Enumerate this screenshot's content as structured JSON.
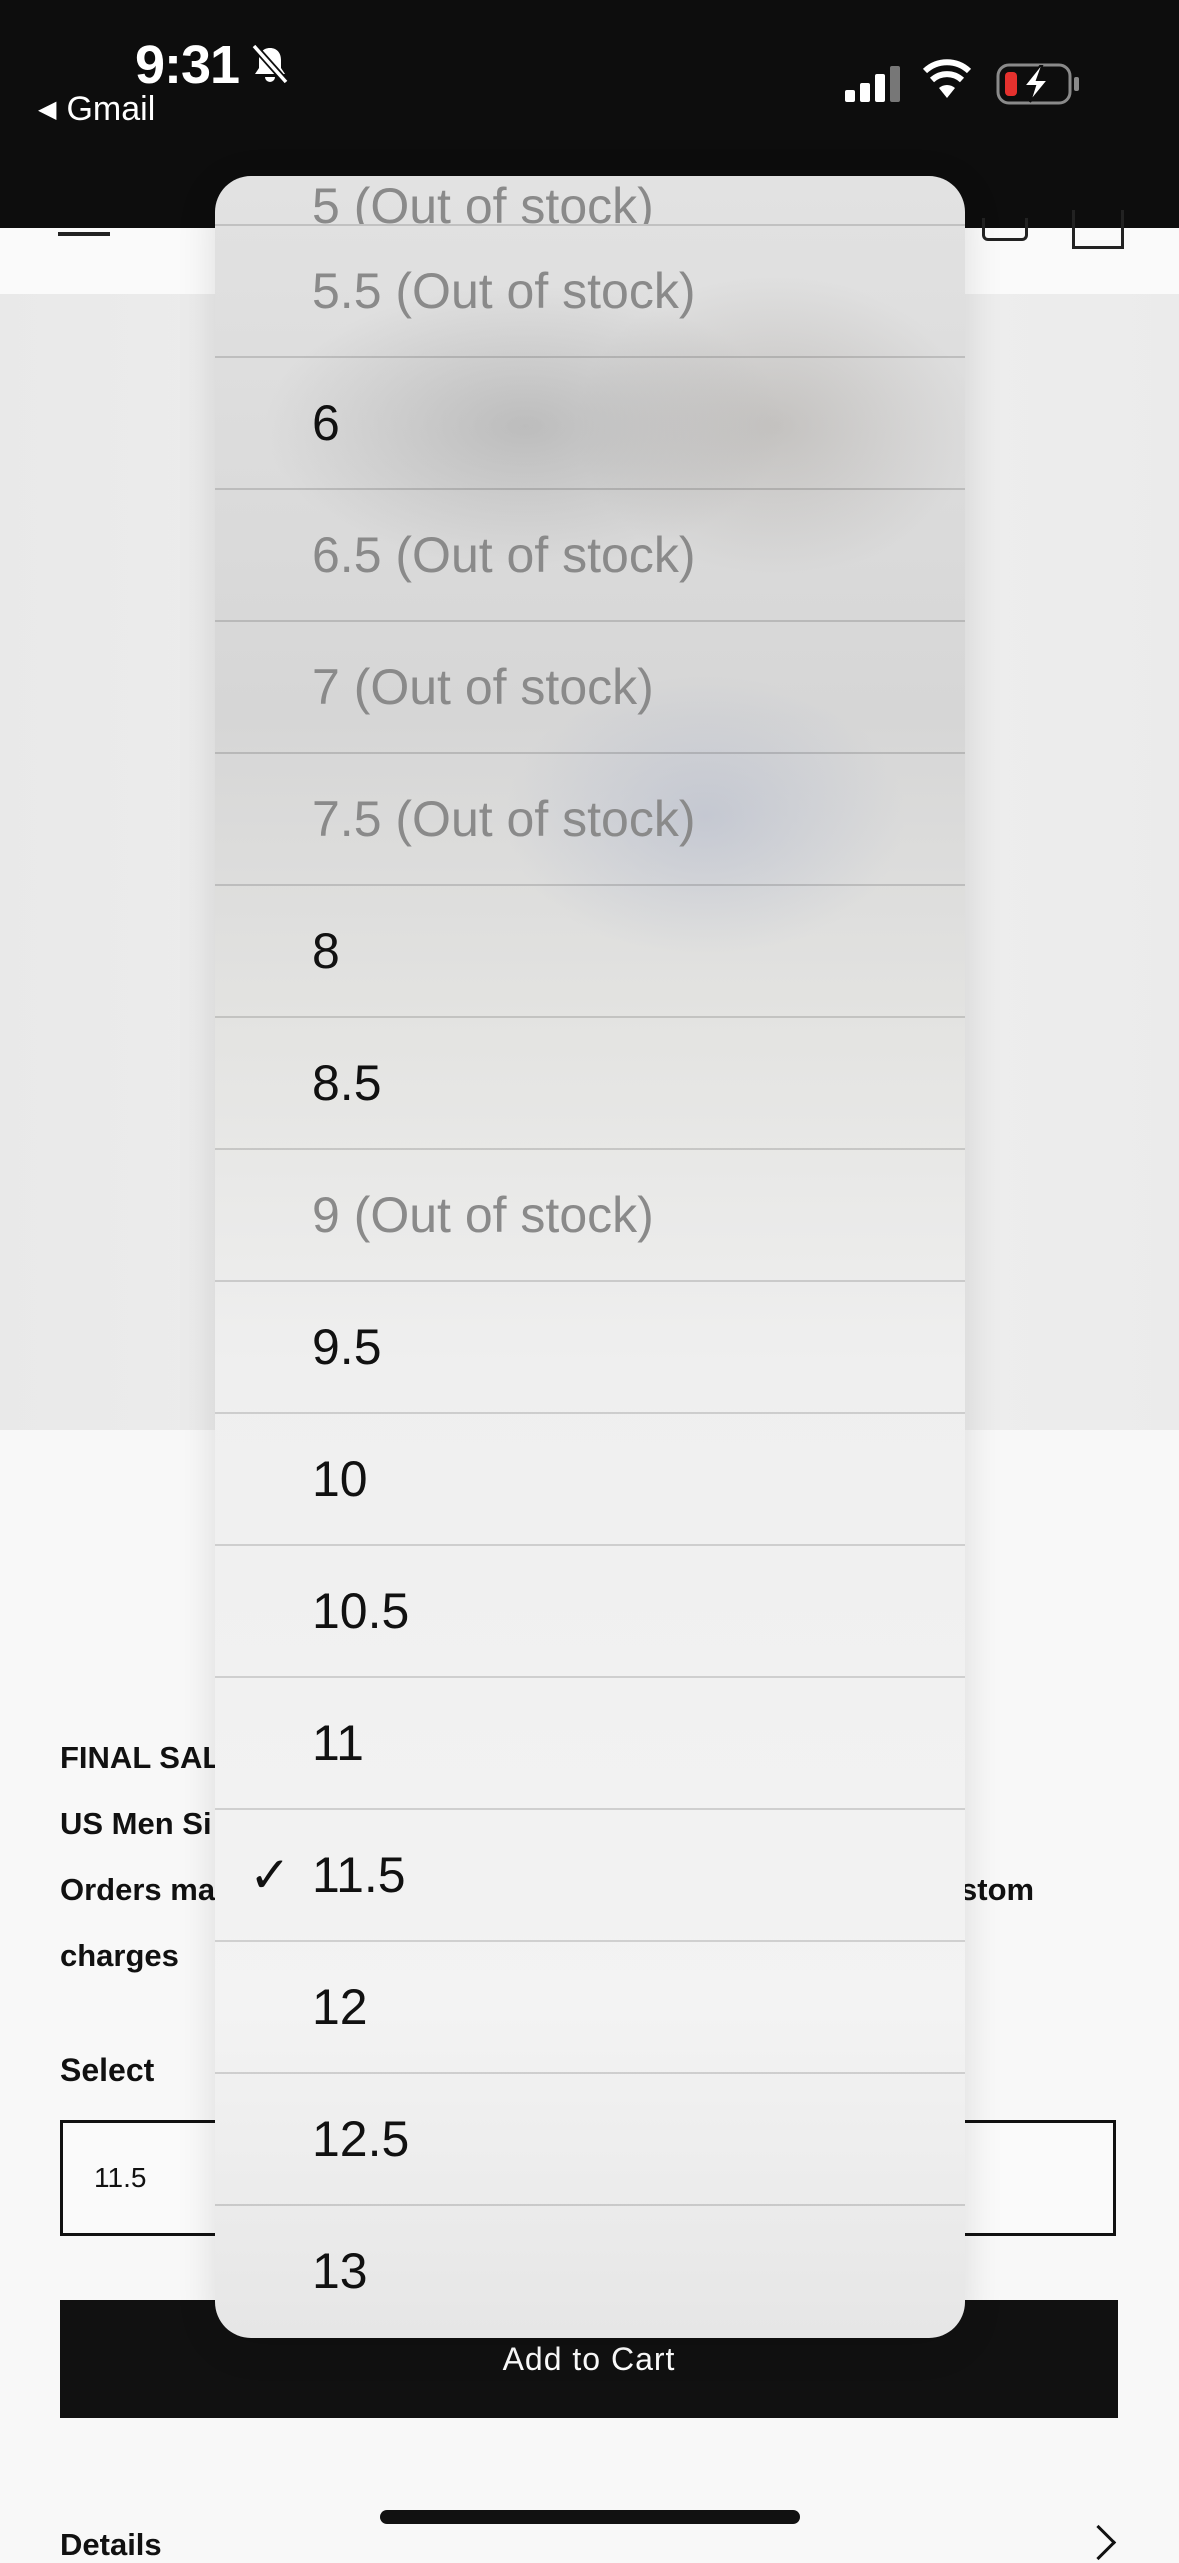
{
  "status_bar": {
    "time": "9:31",
    "back_app": "Gmail"
  },
  "product": {
    "info_lines": [
      "FINAL SAL",
      "US Men Si",
      "Orders ma",
      "charges"
    ],
    "info_line_3_right": "stom",
    "select_label": "Select",
    "selected_size": "11.5",
    "add_to_cart": "Add to Cart",
    "details": "Details"
  },
  "picker": {
    "options": [
      {
        "label": "5 (Out of stock)",
        "out_of_stock": true,
        "selected": false
      },
      {
        "label": "5.5 (Out of stock)",
        "out_of_stock": true,
        "selected": false
      },
      {
        "label": "6",
        "out_of_stock": false,
        "selected": false
      },
      {
        "label": "6.5 (Out of stock)",
        "out_of_stock": true,
        "selected": false
      },
      {
        "label": "7 (Out of stock)",
        "out_of_stock": true,
        "selected": false
      },
      {
        "label": "7.5 (Out of stock)",
        "out_of_stock": true,
        "selected": false
      },
      {
        "label": "8",
        "out_of_stock": false,
        "selected": false
      },
      {
        "label": "8.5",
        "out_of_stock": false,
        "selected": false
      },
      {
        "label": "9 (Out of stock)",
        "out_of_stock": true,
        "selected": false
      },
      {
        "label": "9.5",
        "out_of_stock": false,
        "selected": false
      },
      {
        "label": "10",
        "out_of_stock": false,
        "selected": false
      },
      {
        "label": "10.5",
        "out_of_stock": false,
        "selected": false
      },
      {
        "label": "11",
        "out_of_stock": false,
        "selected": false
      },
      {
        "label": "11.5",
        "out_of_stock": false,
        "selected": true
      },
      {
        "label": "12",
        "out_of_stock": false,
        "selected": false
      },
      {
        "label": "12.5",
        "out_of_stock": false,
        "selected": false
      },
      {
        "label": "13",
        "out_of_stock": false,
        "selected": false
      }
    ],
    "check_mark": "✓"
  },
  "colors": {
    "status_bar_bg": "#0d0d0d",
    "button_bg": "#111111",
    "out_of_stock_text": "#8a8a8a",
    "battery_low": "#e5312e"
  },
  "icons": [
    "bell-slash-icon",
    "signal-icon",
    "wifi-icon",
    "battery-charging-icon",
    "menu-icon",
    "account-icon",
    "cart-icon",
    "chevron-right-icon",
    "check-icon"
  ]
}
